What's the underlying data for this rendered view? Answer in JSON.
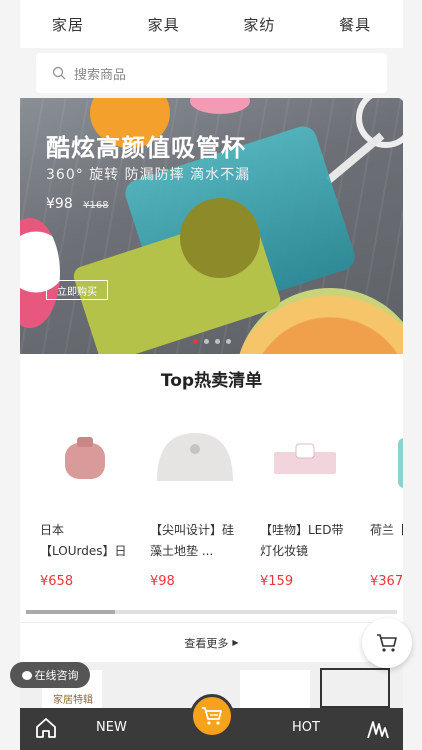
{
  "category_tabs": [
    "家居",
    "家具",
    "家纺",
    "餐具"
  ],
  "search": {
    "placeholder": "搜索商品"
  },
  "banner": {
    "title": "酷炫高颜值吸管杯",
    "subtitle": "360° 旋转 防漏防摔 滴水不漏",
    "price": "¥98",
    "old_price": "¥168",
    "button": "立即购买",
    "slide_count": 4,
    "active_slide": 1
  },
  "top_section": {
    "title": "Top热卖清单",
    "products": [
      {
        "name": "日本【LOUrdes】日式按...",
        "price": "¥658"
      },
      {
        "name": "【尖叫设计】硅藻土地垫 ...",
        "price": "¥98"
      },
      {
        "name": "【哇物】LED带灯化妆镜",
        "price": "¥159"
      },
      {
        "name": "荷兰【design】",
        "price": "¥367"
      }
    ],
    "more_label": "查看更多",
    "scroll_fraction": 0.24
  },
  "feature": {
    "label": "家居特辑"
  },
  "consult_label": "在线咨询",
  "bottom_nav": {
    "new_label": "NEW",
    "hot_label": "HOT"
  },
  "colors": {
    "price": "#e4393c",
    "nav_bg": "#3a3a3a",
    "cart_accent": "#f7a21b"
  }
}
